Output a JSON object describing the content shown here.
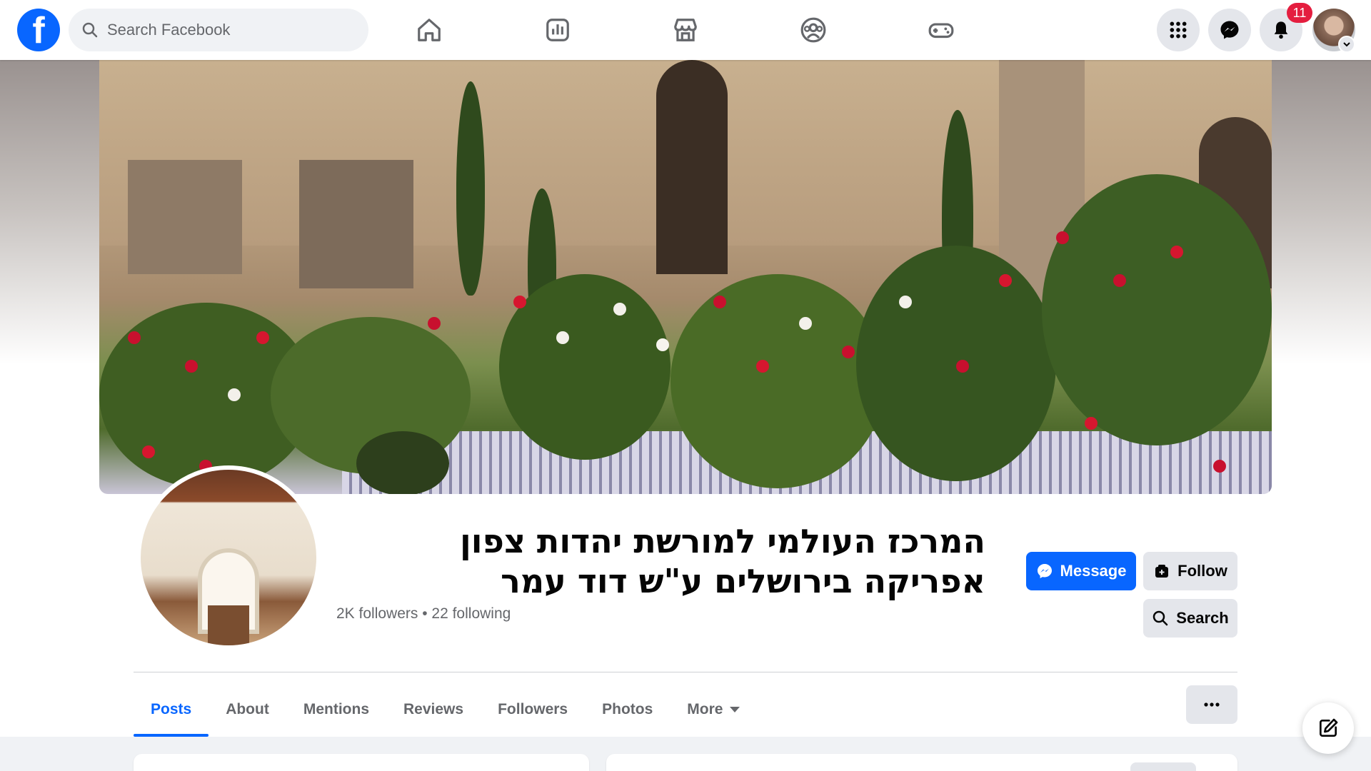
{
  "topbar": {
    "logo": "f",
    "search_placeholder": "Search Facebook",
    "nav_icons": [
      "home-icon",
      "dashboard-icon",
      "marketplace-icon",
      "groups-icon",
      "gaming-icon"
    ],
    "right_icons": [
      "menu-grid-icon",
      "messenger-icon",
      "notifications-icon"
    ],
    "notification_count": "11"
  },
  "profile": {
    "title": "המרכז העולמי למורשת יהדות צפון אפריקה בירושלים ע\"ש דוד עמר",
    "stats": "2K followers • 22 following"
  },
  "actions": {
    "message_label": "Message",
    "follow_label": "Follow",
    "search_label": "Search"
  },
  "tabs": [
    {
      "label": "Posts",
      "active": true
    },
    {
      "label": "About"
    },
    {
      "label": "Mentions"
    },
    {
      "label": "Reviews"
    },
    {
      "label": "Followers"
    },
    {
      "label": "Photos"
    },
    {
      "label": "More"
    }
  ],
  "colors": {
    "brand_blue": "#0866ff",
    "badge_red": "#e41e3f",
    "button_gray": "#e4e6eb",
    "muted_text": "#65676b"
  }
}
